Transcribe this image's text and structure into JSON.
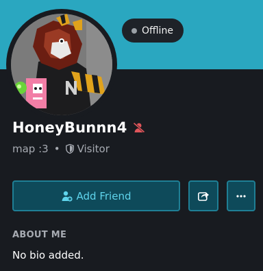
{
  "profile": {
    "username": "HoneyBunnn4",
    "status": "Offline",
    "pronouns": "map :3",
    "separator": "•",
    "rank": "Visitor"
  },
  "actions": {
    "add_friend_label": "Add Friend"
  },
  "about": {
    "title": "ABOUT ME",
    "bio": "No bio added."
  },
  "colors": {
    "banner": "#2aa7c0",
    "background": "#181b20",
    "button_bg": "#0e4a5a",
    "button_border": "#1f7f95",
    "button_text": "#5fd4ec",
    "friend_off_icon": "#e0555a",
    "offline_dot": "#9aa0a6"
  },
  "icons": {
    "friend_status": "user-slash-icon",
    "rank": "shield-icon",
    "add_friend": "user-plus-icon",
    "share": "share-icon",
    "more": "ellipsis-icon"
  }
}
